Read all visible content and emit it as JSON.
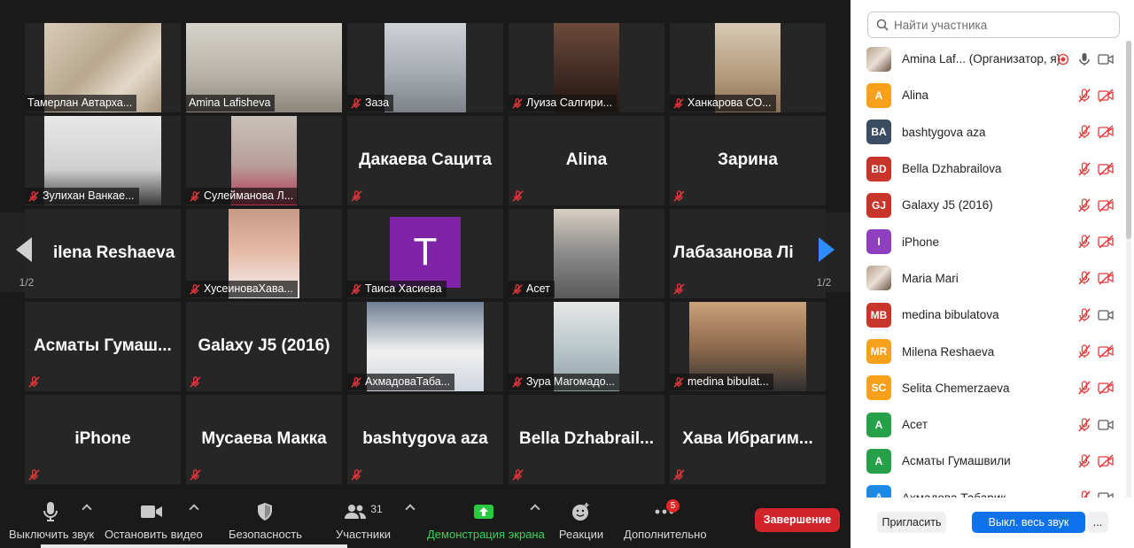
{
  "gallery": {
    "page_indicator": "1/2",
    "tiles": [
      {
        "name": "Тамерлан Автарха...",
        "muted": false
      },
      {
        "name": "Amina Lafisheva",
        "muted": false,
        "active": true
      },
      {
        "name": "Заза",
        "muted": true
      },
      {
        "name": "Луиза Салгири...",
        "muted": true
      },
      {
        "name": "Ханкарова СО...",
        "muted": true
      },
      {
        "name": "Зулихан Ванкае...",
        "muted": true
      },
      {
        "name": "Сулейманова Л...",
        "muted": true
      },
      {
        "big": "Дакаева Сацита",
        "muted": true
      },
      {
        "big": "Alina",
        "muted": true
      },
      {
        "big": "Зарина",
        "muted": true
      },
      {
        "big": "ilena Reshaeva",
        "muted": false
      },
      {
        "name": "ХусеиноваХава...",
        "muted": true
      },
      {
        "name": "Таиса Хасиева",
        "muted": true,
        "avatar_letter": "T"
      },
      {
        "name": "Асет",
        "muted": true
      },
      {
        "big": "Лабазанова Лі",
        "muted": true
      },
      {
        "big": "Асматы Гумаш...",
        "muted": true
      },
      {
        "big": "Galaxy J5 (2016)",
        "muted": true
      },
      {
        "name": "АхмадоваТаба...",
        "muted": true
      },
      {
        "name": "Зура Магомадо...",
        "muted": true
      },
      {
        "name": "medina bibulat...",
        "muted": true
      },
      {
        "big": "iPhone",
        "muted": true
      },
      {
        "big": "Мусаева Макка",
        "muted": true
      },
      {
        "big": "bashtygova aza",
        "muted": true
      },
      {
        "big": "Bella Dzhabrail...",
        "muted": true
      },
      {
        "big": "Хава Ибрагим...",
        "muted": true
      }
    ]
  },
  "toolbar": {
    "mute_label": "Выключить звук",
    "video_label": "Остановить видео",
    "security_label": "Безопасность",
    "participants_label": "Участники",
    "participants_count": "31",
    "share_label": "Демонстрация экрана",
    "reactions_label": "Реакции",
    "more_label": "Дополнительно",
    "more_badge": "5",
    "end_label": "Завершение"
  },
  "panel": {
    "search_placeholder": "Найти участника",
    "invite_label": "Пригласить",
    "mute_all_label": "Выкл. весь звук",
    "more_label": "...",
    "participants": [
      {
        "initials": "",
        "name": "Amina Laf... (Организатор, я)",
        "color": "#ffffff",
        "photo": true,
        "mic": "on",
        "cam": "on",
        "rec": true
      },
      {
        "initials": "A",
        "name": "Alina",
        "color": "#f7a01b",
        "mic": "off",
        "cam": "off"
      },
      {
        "initials": "BA",
        "name": "bashtygova aza",
        "color": "#3b4d63",
        "mic": "off",
        "cam": "off"
      },
      {
        "initials": "BD",
        "name": "Bella Dzhabrailova",
        "color": "#c8352a",
        "mic": "off",
        "cam": "off"
      },
      {
        "initials": "GJ",
        "name": "Galaxy J5 (2016)",
        "color": "#c8352a",
        "mic": "off",
        "cam": "off"
      },
      {
        "initials": "I",
        "name": "iPhone",
        "color": "#8e3fbf",
        "mic": "off",
        "cam": "off"
      },
      {
        "initials": "",
        "name": "Maria Mari",
        "color": "#ffffff",
        "photo": true,
        "mic": "off",
        "cam": "off"
      },
      {
        "initials": "MB",
        "name": "medina bibulatova",
        "color": "#c8352a",
        "mic": "off",
        "cam": "on"
      },
      {
        "initials": "MR",
        "name": "Milena Reshaeva",
        "color": "#f7a01b",
        "mic": "off",
        "cam": "off"
      },
      {
        "initials": "SC",
        "name": "Selita Chemerzaeva",
        "color": "#f7a01b",
        "mic": "off",
        "cam": "off"
      },
      {
        "initials": "A",
        "name": "Асет",
        "color": "#27a04a",
        "mic": "off",
        "cam": "on"
      },
      {
        "initials": "A",
        "name": "Асматы Гумашвили",
        "color": "#27a04a",
        "mic": "off",
        "cam": "off"
      },
      {
        "initials": "A",
        "name": "Ахмадова Табарик",
        "color": "#1e88e5",
        "mic": "off",
        "cam": "on"
      }
    ]
  }
}
